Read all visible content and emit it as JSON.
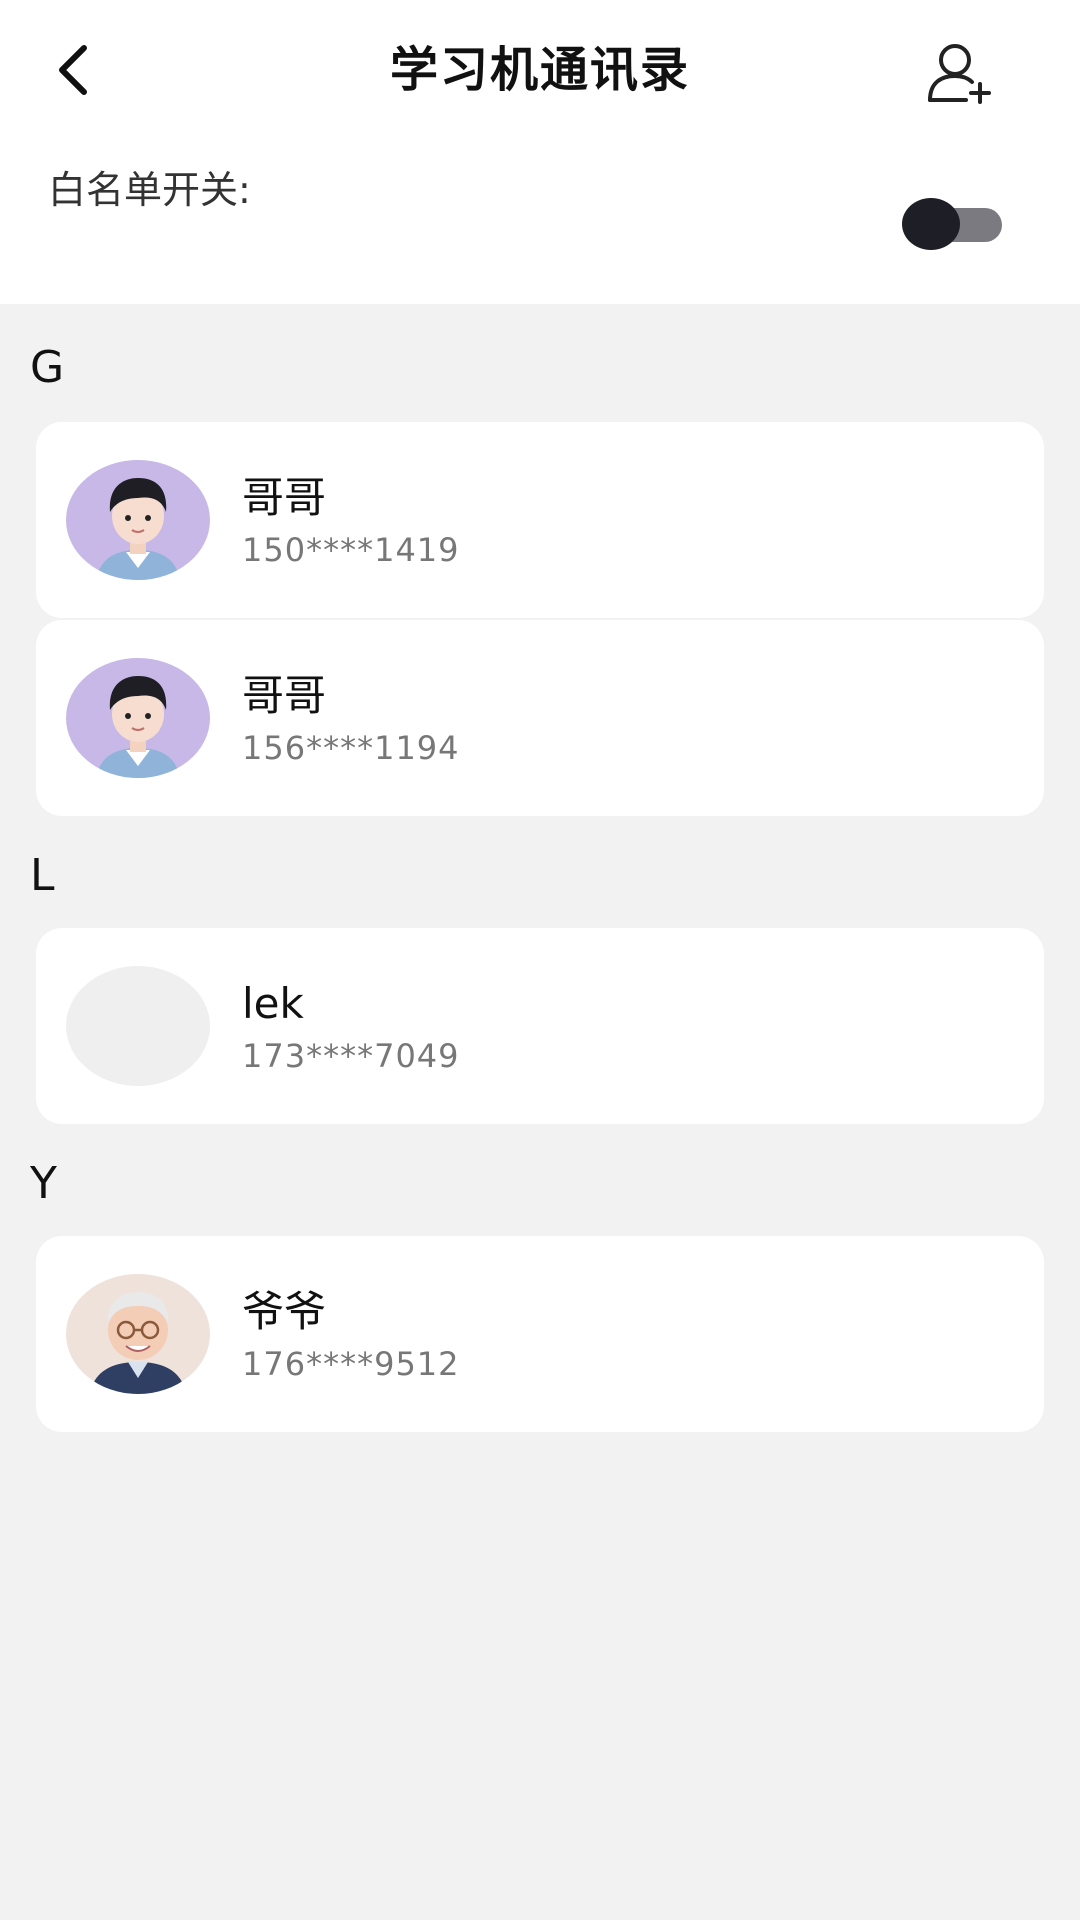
{
  "header": {
    "title": "学习机通讯录",
    "back_icon": "chevron-left-icon",
    "add_icon": "add-user-icon"
  },
  "whitelist": {
    "label": "白名单开关:",
    "enabled": false
  },
  "colors": {
    "card_bg": "#ffffff",
    "page_bg": "#f2f2f2",
    "toggle_track": "#7a7a80",
    "toggle_knob": "#1e1f26",
    "avatar_purple": "#c7b8e8"
  },
  "sections": [
    {
      "letter": "G",
      "contacts": [
        {
          "name": "哥哥",
          "phone": "150****1419",
          "avatar": "boy-avatar"
        },
        {
          "name": "哥哥",
          "phone": "156****1194",
          "avatar": "boy-avatar"
        }
      ]
    },
    {
      "letter": "L",
      "contacts": [
        {
          "name": "lek",
          "phone": "173****7049",
          "avatar": "empty-avatar"
        }
      ]
    },
    {
      "letter": "Y",
      "contacts": [
        {
          "name": "爷爷",
          "phone": "176****9512",
          "avatar": "grandpa-avatar"
        }
      ]
    }
  ]
}
